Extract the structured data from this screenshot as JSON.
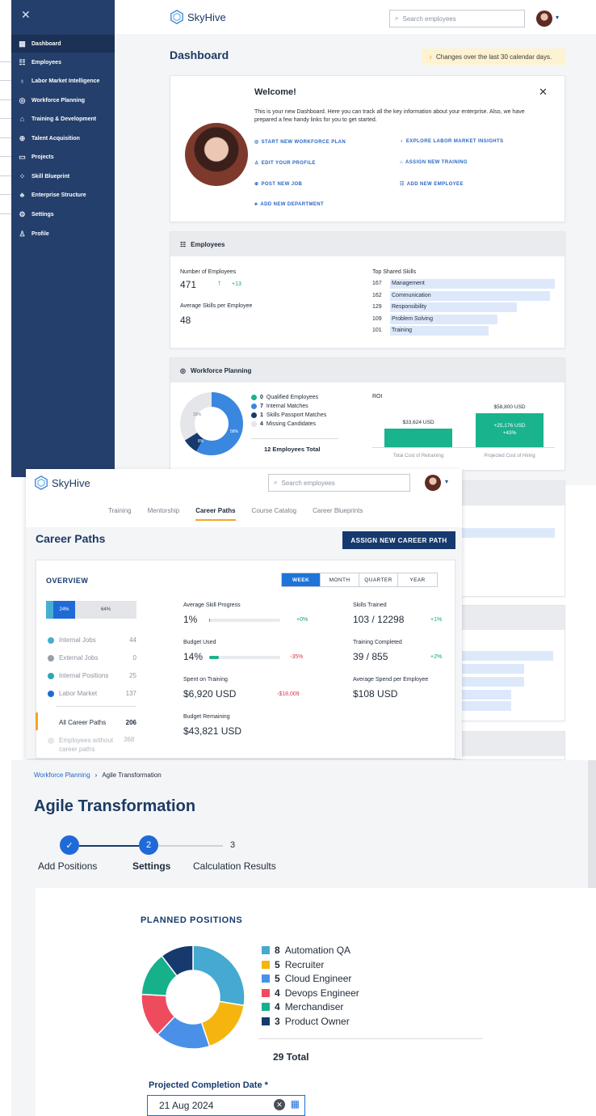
{
  "panel1": {
    "brand": "SkyHive",
    "search_placeholder": "Search employees",
    "sidebar": [
      {
        "label": "Dashboard",
        "icon": "grid-icon"
      },
      {
        "label": "Employees",
        "icon": "people-icon"
      },
      {
        "label": "Labor Market Intelligence",
        "icon": "lightbulb-icon"
      },
      {
        "label": "Workforce Planning",
        "icon": "target-icon"
      },
      {
        "label": "Training & Development",
        "icon": "graduation-cap-icon"
      },
      {
        "label": "Talent Acquisition",
        "icon": "search-people-icon"
      },
      {
        "label": "Projects",
        "icon": "folder-icon"
      },
      {
        "label": "Skill Blueprint",
        "icon": "blueprint-icon"
      },
      {
        "label": "Enterprise Structure",
        "icon": "org-chart-icon"
      },
      {
        "label": "Settings",
        "icon": "gear-icon"
      },
      {
        "label": "Profile",
        "icon": "person-icon"
      }
    ],
    "title": "Dashboard",
    "notice": "Changes over the last 30 calendar days.",
    "welcome": {
      "title": "Welcome!",
      "body": "This is your new Dashboard. Here you can track all the key information about your enterprise. Also, we have prepared a few handy links for you to get started.",
      "links": {
        "start_plan": "START NEW WORKFORCE PLAN",
        "explore": "EXPLORE LABOR MARKET INSIGHTS",
        "edit_profile": "EDIT YOUR PROFILE",
        "assign_training": "ASSIGN NEW TRAINING",
        "post_job": "POST NEW JOB",
        "add_employee": "ADD NEW EMPLOYEE",
        "add_department": "ADD NEW DEPARTMENT"
      }
    },
    "employees": {
      "header": "Employees",
      "num_label": "Number of Employees",
      "num_value": "471",
      "num_delta": "+13",
      "avg_label": "Average Skills per Employee",
      "avg_value": "48",
      "skills_title": "Top Shared Skills",
      "skills": [
        {
          "count": "167",
          "name": "Management",
          "share": 1.0
        },
        {
          "count": "162",
          "name": "Communication",
          "share": 0.97
        },
        {
          "count": "129",
          "name": "Responsibility",
          "share": 0.77
        },
        {
          "count": "109",
          "name": "Problem Solving",
          "share": 0.65
        },
        {
          "count": "101",
          "name": "Training",
          "share": 0.6
        }
      ]
    },
    "workforce": {
      "header": "Workforce Planning",
      "donut_labels": {
        "a": "33%",
        "b": "58%",
        "c": "8%"
      },
      "legend": [
        {
          "count": "0",
          "text": "Qualified Employees",
          "color": "#19b38e"
        },
        {
          "count": "7",
          "text": "Internal Matches",
          "color": "#3a87e0"
        },
        {
          "count": "1",
          "text": "Skills Passport Matches",
          "color": "#163a6e"
        },
        {
          "count": "4",
          "text": "Missing Candidates",
          "color": "#e4e6ea"
        }
      ],
      "total": "12 Employees Total",
      "roi_title": "ROI",
      "bar1_value": "$33,624 USD",
      "bar2_value": "$58,800 USD",
      "bar2_inner1": "+25,176 USD",
      "bar2_inner2": "+43%",
      "bar1_label": "Total Cost of Retraining",
      "bar2_label": "Projected Cost of Hiring"
    }
  },
  "panel2": {
    "brand": "SkyHive",
    "search_placeholder": "Search employees",
    "tabs": [
      "Training",
      "Mentorship",
      "Career Paths",
      "Course Catalog",
      "Career Blueprints"
    ],
    "title": "Career Paths",
    "assign_button": "ASSIGN NEW CAREER PATH",
    "overview": "OVERVIEW",
    "periods": [
      "WEEK",
      "MONTH",
      "QUARTER",
      "YEAR"
    ],
    "stack": {
      "first": "24%",
      "second": "64%"
    },
    "legend": [
      {
        "label": "Internal Jobs",
        "count": "44",
        "color": "#45afd2"
      },
      {
        "label": "External Jobs",
        "count": "0",
        "color": "#9aa0a8"
      },
      {
        "label": "Internal Positions",
        "count": "25",
        "color": "#2fa6b8"
      },
      {
        "label": "Labor Market",
        "count": "137",
        "color": "#1f6ad6"
      }
    ],
    "all_paths_label": "All Career Paths",
    "all_paths_count": "206",
    "without_label": "Employees without career paths",
    "without_count": "368",
    "stats": {
      "avg_progress_label": "Average Skill Progress",
      "avg_progress_value": "1%",
      "avg_progress_delta": "+0%",
      "avg_progress_fraction": 0.01,
      "budget_used_label": "Budget Used",
      "budget_used_value": "14%",
      "budget_used_delta": "-35%",
      "budget_used_fraction": 0.14,
      "spent_label": "Spent on Training",
      "spent_value": "$6,920 USD",
      "spent_delta": "-$18,009",
      "remaining_label": "Budget Remaining",
      "remaining_value": "$43,821 USD",
      "skills_trained_label": "Skills Trained",
      "skills_trained_value": "103 / 12298",
      "skills_trained_delta": "+1%",
      "training_completed_label": "Training Completed",
      "training_completed_value": "39 / 855",
      "training_completed_delta": "+2%",
      "avg_spend_label": "Average Spend per Employee",
      "avg_spend_value": "$108 USD"
    }
  },
  "panel3": {
    "breadcrumb_parent": "Workforce Planning",
    "breadcrumb_current": "Agile Transformation",
    "title": "Agile Transformation",
    "steps": [
      {
        "number": "1",
        "label": "Add Positions",
        "state": "done"
      },
      {
        "number": "2",
        "label": "Settings",
        "state": "current"
      },
      {
        "number": "3",
        "label": "Calculation Results",
        "state": "todo"
      }
    ],
    "section_title": "PLANNED POSITIONS",
    "chart_data": {
      "type": "pie",
      "categories": [
        "Automation QA",
        "Recruiter",
        "Cloud Engineer",
        "Devops Engineer",
        "Merchandiser",
        "Product Owner"
      ],
      "values": [
        8,
        5,
        5,
        4,
        4,
        3
      ],
      "colors": [
        "#45a9d1",
        "#f5b50e",
        "#4a90e8",
        "#ef4b5e",
        "#16b08b",
        "#163a6e"
      ]
    },
    "total": "29 Total",
    "date_label": "Projected Completion Date *",
    "date_value": "21 Aug 2024"
  }
}
